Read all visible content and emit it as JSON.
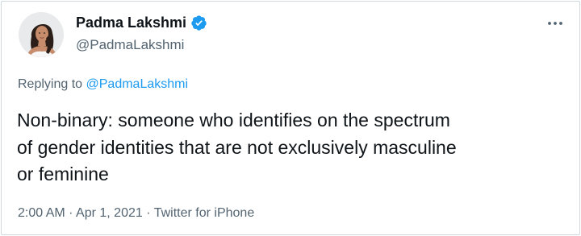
{
  "author": {
    "name": "Padma Lakshmi",
    "handle": "@PadmaLakshmi",
    "verified": true
  },
  "reply_context": {
    "prefix": "Replying to",
    "mention": "@PadmaLakshmi"
  },
  "tweet": {
    "text": "Non-binary: someone who identifies on the spectrum\nof gender identities that are not exclusively masculine\nor feminine"
  },
  "meta": {
    "time": "2:00 AM",
    "separator": "·",
    "date": "Apr 1, 2021",
    "source": "Twitter for iPhone"
  },
  "icons": {
    "verified": "verified-badge-icon",
    "more": "more-options-icon"
  },
  "colors": {
    "accent": "#1d9bf0",
    "secondary_text": "#536471",
    "primary_text": "#0f1419",
    "border": "#cfd9de"
  }
}
